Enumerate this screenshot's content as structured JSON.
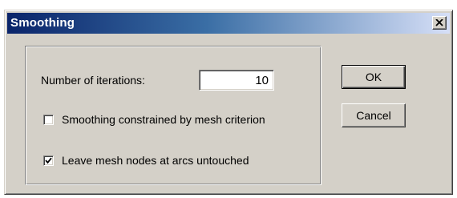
{
  "window": {
    "title": "Smoothing",
    "close_glyph": "×"
  },
  "form": {
    "iterations_label": "Number of iterations:",
    "iterations_value": "10",
    "constrained_checkbox": {
      "label": "Smoothing constrained by mesh criterion",
      "checked": false
    },
    "leave_nodes_checkbox": {
      "label": "Leave mesh nodes at arcs untouched",
      "checked": true
    }
  },
  "buttons": {
    "ok_label": "OK",
    "cancel_label": "Cancel"
  },
  "colors": {
    "dialog_face": "#d4d0c8",
    "title_start": "#0a246a",
    "title_end": "#d6dff7"
  }
}
